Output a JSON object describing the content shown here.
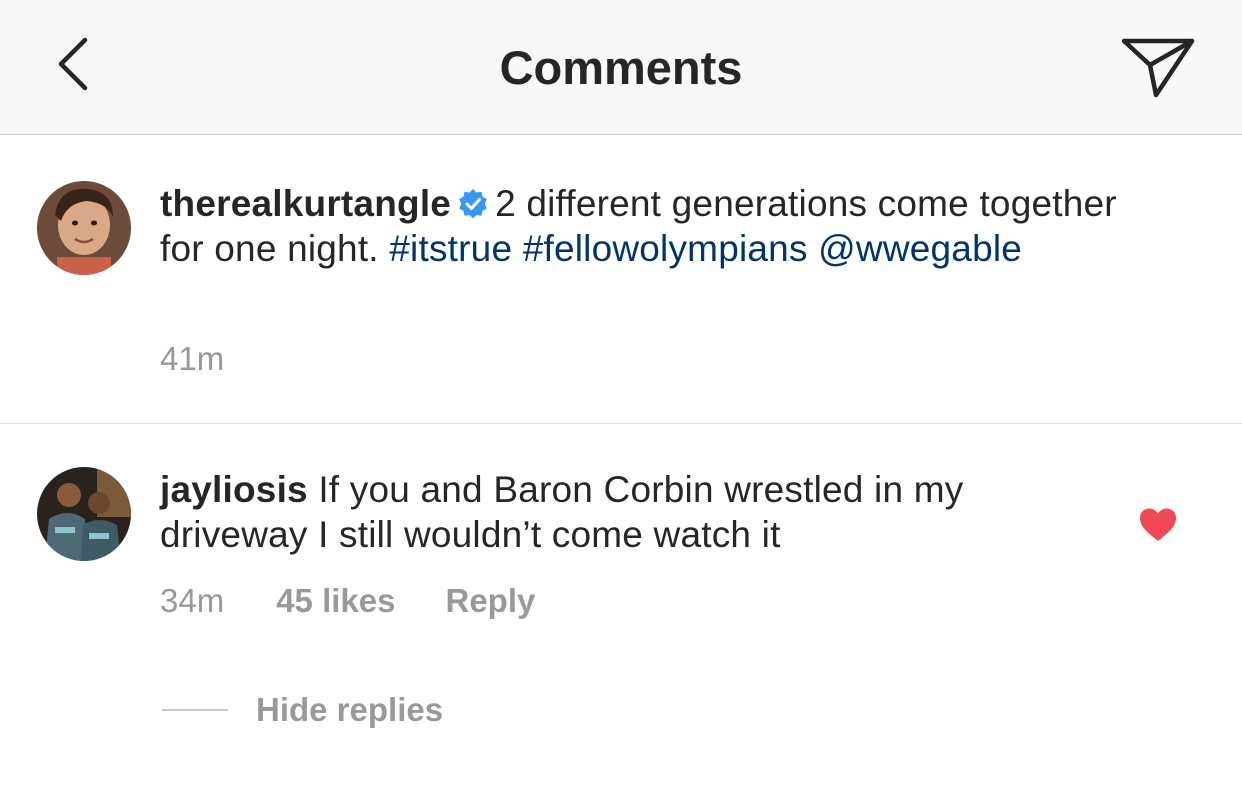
{
  "header": {
    "title": "Comments",
    "back_icon": "chevron-left-icon",
    "send_icon": "paper-plane-icon"
  },
  "caption": {
    "username": "therealkurtangle",
    "verified_icon": "verified-badge-icon",
    "text": "2 different generations come together for one night.",
    "hashtags": [
      "#itstrue",
      "#fellowolympians"
    ],
    "mention": "@wwegable",
    "time": "41m"
  },
  "comment": {
    "username": "jayliosis",
    "text": "If you and Baron Corbin wrestled in my driveway I still wouldn’t come watch it",
    "time": "34m",
    "likes": "45 likes",
    "reply_label": "Reply",
    "liked": true,
    "heart_color": "#ed4956",
    "hide_replies_label": "Hide replies"
  },
  "colors": {
    "link": "#003569",
    "muted": "#999999",
    "verified": "#3897f0"
  }
}
